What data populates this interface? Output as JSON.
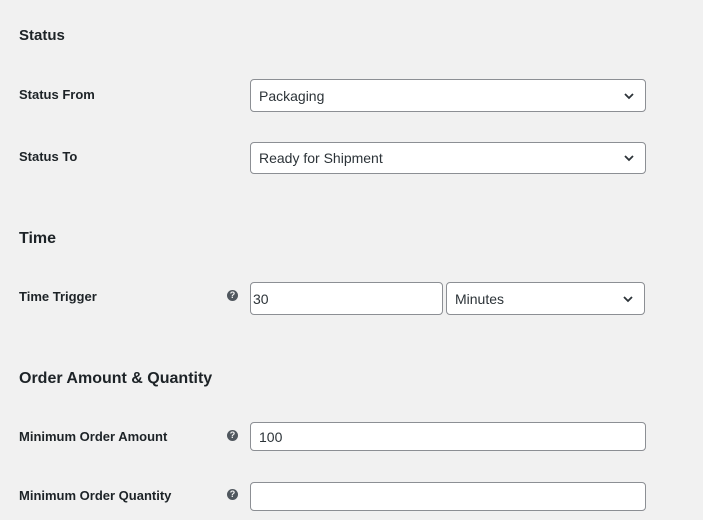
{
  "sections": {
    "status": {
      "title": "Status"
    },
    "time": {
      "title": "Time"
    },
    "order": {
      "title": "Order Amount & Quantity"
    }
  },
  "status_from": {
    "label": "Status From",
    "value": "Packaging"
  },
  "status_to": {
    "label": "Status To",
    "value": "Ready for Shipment"
  },
  "time_trigger": {
    "label": "Time Trigger",
    "help_glyph": "?",
    "value": "30",
    "unit": "Minutes"
  },
  "min_amount": {
    "label": "Minimum Order Amount",
    "help_glyph": "?",
    "value": "100"
  },
  "min_quantity": {
    "label": "Minimum Order Quantity",
    "help_glyph": "?",
    "value": ""
  },
  "icons": {
    "select_arrow": "chevron-down-icon",
    "help": "question-circle-icon"
  }
}
